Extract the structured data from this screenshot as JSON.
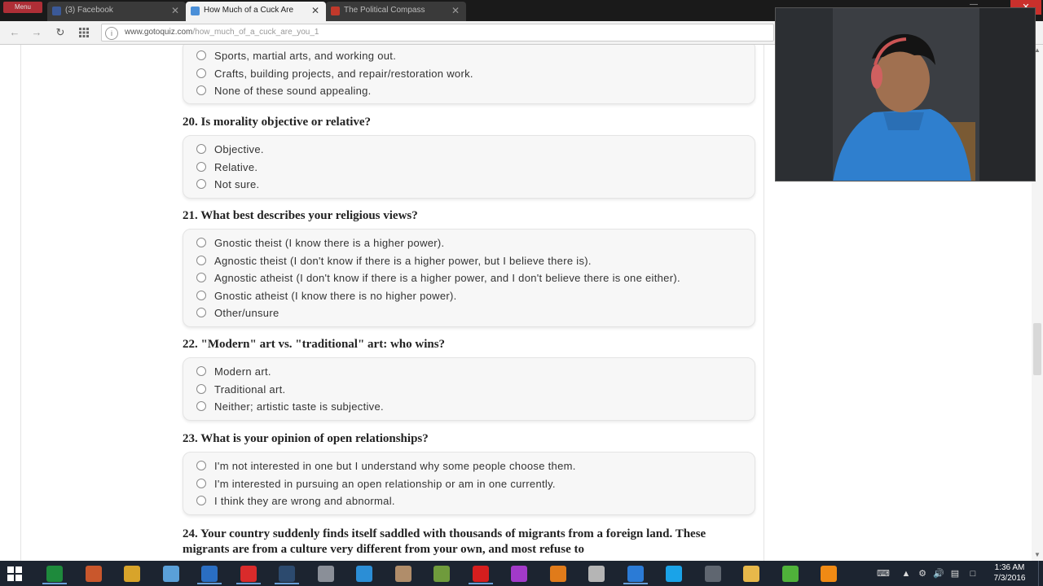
{
  "browser": {
    "app_badge": "Menu",
    "tabs": [
      {
        "label": "(3) Facebook",
        "active": false,
        "favicon_color": "#3b5998"
      },
      {
        "label": "How Much of a Cuck Are",
        "active": true,
        "favicon_color": "#4a8fd8"
      },
      {
        "label": "The Political Compass",
        "active": false,
        "favicon_color": "#c0392b"
      }
    ],
    "close_symbol": "✕",
    "address": {
      "host": "www.gotoquiz.com",
      "path": "/how_much_of_a_cuck_are_you_1"
    },
    "minimize_symbol": "—"
  },
  "quiz": {
    "q19_partial_options": [
      "Sports, martial arts, and working out.",
      "Crafts, building projects, and repair/restoration work.",
      "None of these sound appealing."
    ],
    "questions": [
      {
        "title": "20. Is morality objective or relative?",
        "options": [
          "Objective.",
          "Relative.",
          "Not sure."
        ]
      },
      {
        "title": "21. What best describes your religious views?",
        "options": [
          "Gnostic theist (I know there is a higher power).",
          "Agnostic theist (I don't know if there is a higher power, but I believe there is).",
          "Agnostic atheist (I don't know if there is a higher power, and I don't believe there is one either).",
          "Gnostic atheist (I know there is no higher power).",
          "Other/unsure"
        ]
      },
      {
        "title": "22. \"Modern\" art vs. \"traditional\" art: who wins?",
        "options": [
          "Modern art.",
          "Traditional art.",
          "Neither; artistic taste is subjective."
        ]
      },
      {
        "title": "23. What is your opinion of open relationships?",
        "options": [
          "I'm not interested in one but I understand why some people choose them.",
          "I'm interested in pursuing an open relationship or am in one currently.",
          "I think they are wrong and abnormal."
        ]
      }
    ],
    "q24_title": "24. Your country suddenly finds itself saddled with thousands of migrants from a foreign land. These migrants are from a culture very different from your own, and most refuse to"
  },
  "taskbar": {
    "clock_time": "1:36 AM",
    "clock_date": "7/3/2016",
    "icons": [
      {
        "name": "spreadsheet-icon",
        "color": "#1e8a3c"
      },
      {
        "name": "pictures-app-icon",
        "color": "#c9572c"
      },
      {
        "name": "star-app-icon",
        "color": "#d8a42a"
      },
      {
        "name": "notepad-icon",
        "color": "#5aa0d8"
      },
      {
        "name": "thunderbird-icon",
        "color": "#2a6ec2"
      },
      {
        "name": "opera-icon",
        "color": "#d92b2b"
      },
      {
        "name": "steam-icon",
        "color": "#2c4a6e"
      },
      {
        "name": "printer-icon",
        "color": "#8a8f98"
      },
      {
        "name": "skype-circle-icon",
        "color": "#2b8ed6"
      },
      {
        "name": "paint-icon",
        "color": "#b08d6a"
      },
      {
        "name": "minecraft-icon",
        "color": "#6f9b3c"
      },
      {
        "name": "record-icon",
        "color": "#d61e1e"
      },
      {
        "name": "castle-game-icon",
        "color": "#a23ac9"
      },
      {
        "name": "video-player-icon",
        "color": "#e07b1a"
      },
      {
        "name": "cd-icon",
        "color": "#b5b5b5"
      },
      {
        "name": "virtualbox-icon",
        "color": "#2b7bd6"
      },
      {
        "name": "skype-icon",
        "color": "#1aa3e8"
      },
      {
        "name": "audio-editor-icon",
        "color": "#5f6670"
      },
      {
        "name": "file-explorer-icon",
        "color": "#e7b84a"
      },
      {
        "name": "utorrent-icon",
        "color": "#4fb23a"
      },
      {
        "name": "vlc-icon",
        "color": "#f08a14"
      }
    ]
  }
}
